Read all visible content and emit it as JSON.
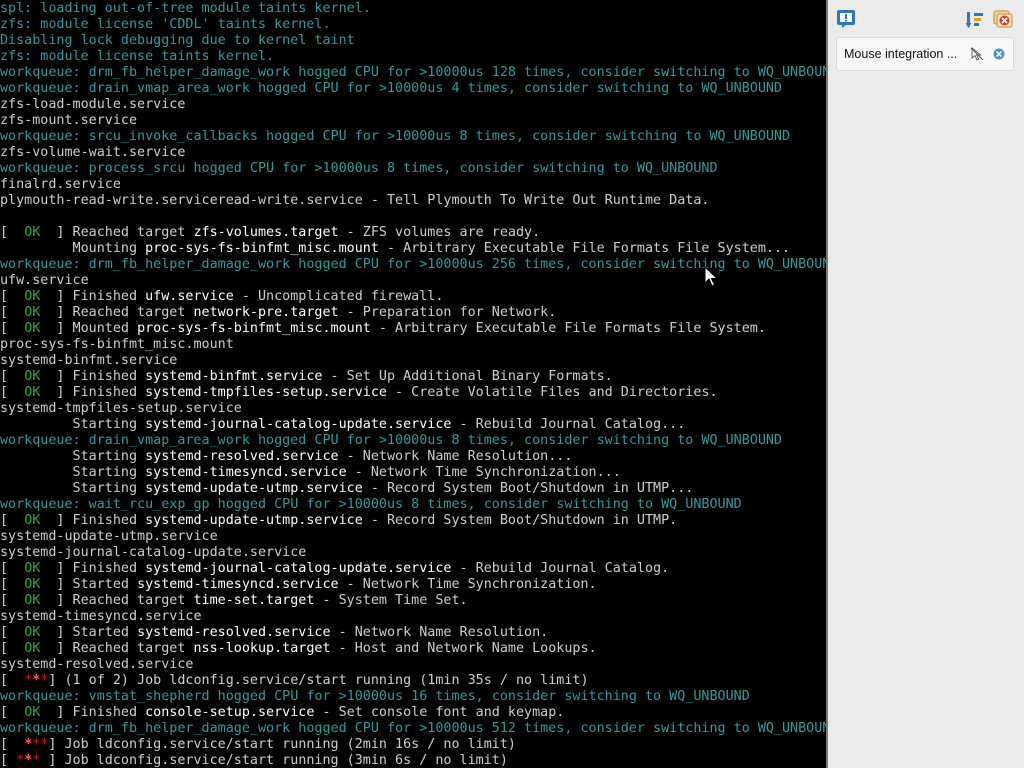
{
  "console": {
    "colors": {
      "default": "#cfcfcf",
      "bright": "#ffffff",
      "ok": "#1fa84a",
      "workqueue": "#2a9d9a",
      "error": "#d62020",
      "error_bright": "#ff5a5a"
    },
    "lines": [
      [
        [
          "spl: loading out-of-tree module taints kernel.",
          "t"
        ]
      ],
      [
        [
          "zfs: module license 'CDDL' taints kernel.",
          "t"
        ]
      ],
      [
        [
          "Disabling lock debugging due to kernel taint",
          "t"
        ]
      ],
      [
        [
          "zfs: module license taints kernel.",
          "t"
        ]
      ],
      [
        [
          "workqueue: drm_fb_helper_damage_work hogged CPU for >10000us 128 times, consider switching to WQ_UNBOUND",
          "t"
        ]
      ],
      [
        [
          "workqueue: drain_vmap_area_work hogged CPU for >10000us 4 times, consider switching to WQ_UNBOUND",
          "t"
        ]
      ],
      [
        [
          "zfs-load-module.service",
          "w"
        ]
      ],
      [
        [
          "zfs-mount.service",
          "w"
        ]
      ],
      [
        [
          "workqueue: srcu_invoke_callbacks hogged CPU for >10000us 8 times, consider switching to WQ_UNBOUND",
          "t"
        ]
      ],
      [
        [
          "zfs-volume-wait.service",
          "w"
        ]
      ],
      [
        [
          "workqueue: process_srcu hogged CPU for >10000us 8 times, consider switching to WQ_UNBOUND",
          "t"
        ]
      ],
      [
        [
          "finalrd.service",
          "w"
        ]
      ],
      [
        [
          "plymouth-read-write.serviceread-write.service",
          "w"
        ],
        [
          " - Tell Plymouth To Write Out Runtime Data.",
          "w"
        ]
      ],
      [],
      [
        [
          "[  ",
          "w"
        ],
        [
          "OK",
          "g"
        ],
        [
          "  ] Reached target ",
          "w"
        ],
        [
          "zfs-volumes.target",
          "b"
        ],
        [
          " - ZFS volumes are ready.",
          "w"
        ]
      ],
      [
        [
          "         Mounting ",
          "w"
        ],
        [
          "proc-sys-fs-binfmt_misc.mount",
          "b"
        ],
        [
          " - Arbitrary Executable File Formats File System...",
          "w"
        ]
      ],
      [
        [
          "workqueue: drm_fb_helper_damage_work hogged CPU for >10000us 256 times, consider switching to WQ_UNBOUND",
          "t"
        ]
      ],
      [
        [
          "ufw.service",
          "w"
        ]
      ],
      [
        [
          "[  ",
          "w"
        ],
        [
          "OK",
          "g"
        ],
        [
          "  ] Finished ",
          "w"
        ],
        [
          "ufw.service",
          "b"
        ],
        [
          " - Uncomplicated firewall.",
          "w"
        ]
      ],
      [
        [
          "[  ",
          "w"
        ],
        [
          "OK",
          "g"
        ],
        [
          "  ] Reached target ",
          "w"
        ],
        [
          "network-pre.target",
          "b"
        ],
        [
          " - Preparation for Network.",
          "w"
        ]
      ],
      [
        [
          "[  ",
          "w"
        ],
        [
          "OK",
          "g"
        ],
        [
          "  ] Mounted ",
          "w"
        ],
        [
          "proc-sys-fs-binfmt_misc.mount",
          "b"
        ],
        [
          " - Arbitrary Executable File Formats File System.",
          "w"
        ]
      ],
      [
        [
          "proc-sys-fs-binfmt_misc.mount",
          "w"
        ]
      ],
      [
        [
          "systemd-binfmt.service",
          "w"
        ]
      ],
      [
        [
          "[  ",
          "w"
        ],
        [
          "OK",
          "g"
        ],
        [
          "  ] Finished ",
          "w"
        ],
        [
          "systemd-binfmt.service",
          "b"
        ],
        [
          " - Set Up Additional Binary Formats.",
          "w"
        ]
      ],
      [
        [
          "[  ",
          "w"
        ],
        [
          "OK",
          "g"
        ],
        [
          "  ] Finished ",
          "w"
        ],
        [
          "systemd-tmpfiles-setup.service",
          "b"
        ],
        [
          " - Create Volatile Files and Directories.",
          "w"
        ]
      ],
      [
        [
          "systemd-tmpfiles-setup.service",
          "w"
        ]
      ],
      [
        [
          "         Starting ",
          "w"
        ],
        [
          "systemd-journal-catalog-update.service",
          "b"
        ],
        [
          " - Rebuild Journal Catalog...",
          "w"
        ]
      ],
      [
        [
          "workqueue: drain_vmap_area_work hogged CPU for >10000us 8 times, consider switching to WQ_UNBOUND",
          "t"
        ]
      ],
      [
        [
          "         Starting ",
          "w"
        ],
        [
          "systemd-resolved.service",
          "b"
        ],
        [
          " - Network Name Resolution...",
          "w"
        ]
      ],
      [
        [
          "         Starting ",
          "w"
        ],
        [
          "systemd-timesyncd.service",
          "b"
        ],
        [
          " - Network Time Synchronization...",
          "w"
        ]
      ],
      [
        [
          "         Starting ",
          "w"
        ],
        [
          "systemd-update-utmp.service",
          "b"
        ],
        [
          " - Record System Boot/Shutdown in UTMP...",
          "w"
        ]
      ],
      [
        [
          "workqueue: wait_rcu_exp_gp hogged CPU for >10000us 8 times, consider switching to WQ_UNBOUND",
          "t"
        ]
      ],
      [
        [
          "[  ",
          "w"
        ],
        [
          "OK",
          "g"
        ],
        [
          "  ] Finished ",
          "w"
        ],
        [
          "systemd-update-utmp.service",
          "b"
        ],
        [
          " - Record System Boot/Shutdown in UTMP.",
          "w"
        ]
      ],
      [
        [
          "systemd-update-utmp.service",
          "w"
        ]
      ],
      [
        [
          "systemd-journal-catalog-update.service",
          "w"
        ]
      ],
      [
        [
          "[  ",
          "w"
        ],
        [
          "OK",
          "g"
        ],
        [
          "  ] Finished ",
          "w"
        ],
        [
          "systemd-journal-catalog-update.service",
          "b"
        ],
        [
          " - Rebuild Journal Catalog.",
          "w"
        ]
      ],
      [
        [
          "[  ",
          "w"
        ],
        [
          "OK",
          "g"
        ],
        [
          "  ] Started ",
          "w"
        ],
        [
          "systemd-timesyncd.service",
          "b"
        ],
        [
          " - Network Time Synchronization.",
          "w"
        ]
      ],
      [
        [
          "[  ",
          "w"
        ],
        [
          "OK",
          "g"
        ],
        [
          "  ] Reached target ",
          "w"
        ],
        [
          "time-set.target",
          "b"
        ],
        [
          " - System Time Set.",
          "w"
        ]
      ],
      [
        [
          "systemd-timesyncd.service",
          "w"
        ]
      ],
      [
        [
          "[  ",
          "w"
        ],
        [
          "OK",
          "g"
        ],
        [
          "  ] Started ",
          "w"
        ],
        [
          "systemd-resolved.service",
          "b"
        ],
        [
          " - Network Name Resolution.",
          "w"
        ]
      ],
      [
        [
          "[  ",
          "w"
        ],
        [
          "OK",
          "g"
        ],
        [
          "  ] Reached target ",
          "w"
        ],
        [
          "nss-lookup.target",
          "b"
        ],
        [
          " - Host and Network Name Lookups.",
          "w"
        ]
      ],
      [
        [
          "systemd-resolved.service",
          "w"
        ]
      ],
      [
        [
          "[  ",
          "w"
        ],
        [
          "*",
          "r"
        ],
        [
          "*",
          "rb"
        ],
        [
          "*",
          "r"
        ],
        [
          "] (1 of 2) Job ldconfig.service/start running (1min 35s / no limit)",
          "w"
        ]
      ],
      [
        [
          "workqueue: vmstat_shepherd hogged CPU for >10000us 16 times, consider switching to WQ_UNBOUND",
          "t"
        ]
      ],
      [
        [
          "[  ",
          "w"
        ],
        [
          "OK",
          "g"
        ],
        [
          "  ] Finished ",
          "w"
        ],
        [
          "console-setup.service",
          "b"
        ],
        [
          " - Set console font and keymap.",
          "w"
        ]
      ],
      [
        [
          "workqueue: drm_fb_helper_damage_work hogged CPU for >10000us 512 times, consider switching to WQ_UNBOUND",
          "t"
        ]
      ],
      [
        [
          "[  ",
          "w"
        ],
        [
          "*",
          "rb"
        ],
        [
          "*",
          "r"
        ],
        [
          "*",
          "r"
        ],
        [
          "] Job ldconfig.service/start running (2min 16s / no limit)",
          "w"
        ]
      ],
      [
        [
          "[ ",
          "w"
        ],
        [
          "*",
          "r"
        ],
        [
          "*",
          "rb"
        ],
        [
          "*",
          "r"
        ],
        [
          " ] Job ldconfig.service/start running (3min 6s / no limit)",
          "w"
        ]
      ]
    ]
  },
  "panel": {
    "background": "#ebebeb",
    "icons": {
      "top_left": "notification-center-icon",
      "top_right_1": "sort-icon",
      "top_right_2": "close-all-icon"
    },
    "notification": {
      "text": "Mouse integration ...",
      "action_icon": "mouse-pointer-off-icon",
      "close_icon": "close-icon"
    }
  }
}
